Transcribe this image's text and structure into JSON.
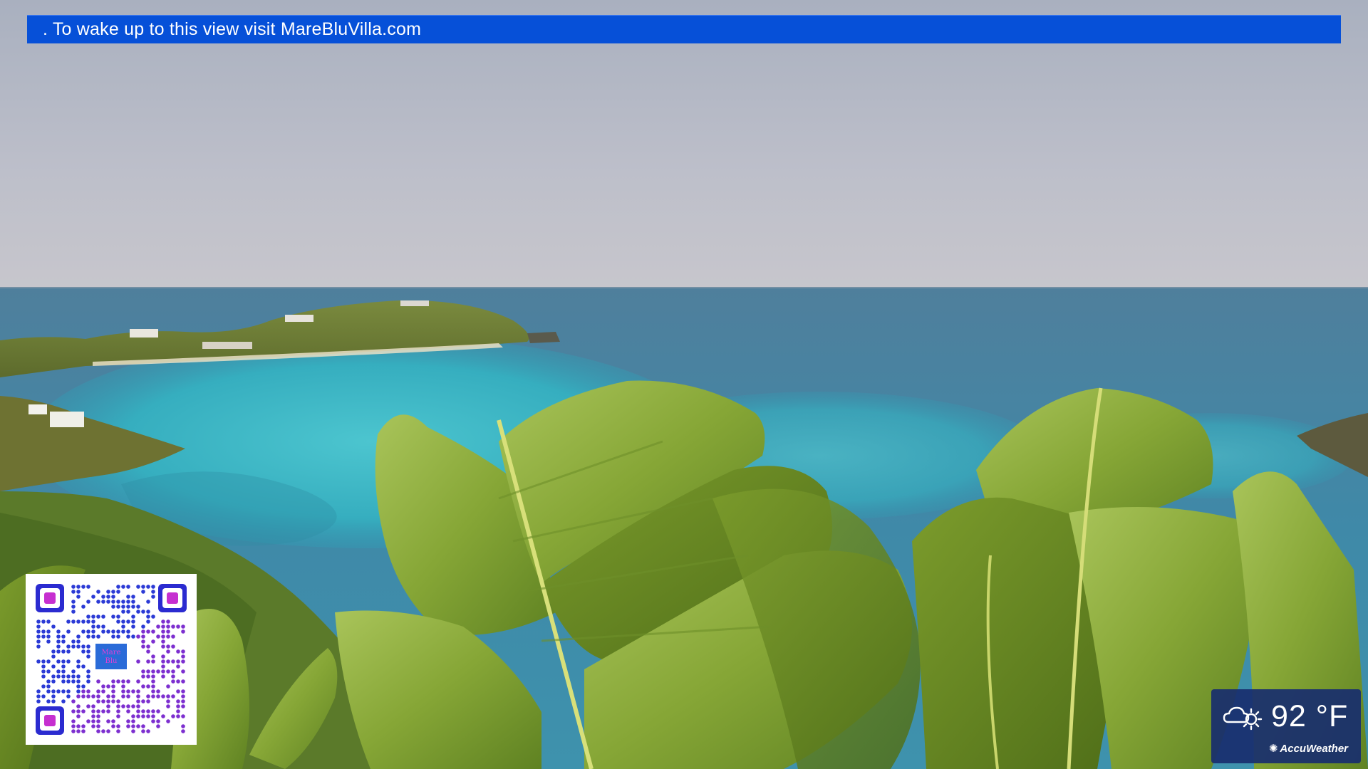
{
  "ticker": {
    "text": ". To wake up to this view visit MareBluVilla.com",
    "background": "#0650d8"
  },
  "qr": {
    "center_logo_text": [
      "Mare",
      "Blu"
    ],
    "accent_color": "#c62fd0",
    "module_color": "#2b2bd0"
  },
  "weather": {
    "icon": "partly-cloudy-sun-icon",
    "temperature": "92 °F",
    "brand": "AccuWeather",
    "brand_icon": "sun-burst-icon"
  },
  "scene": {
    "subject": "tropical bay",
    "sky_color": "#b9bcc6",
    "sea_color": "#3e8aa8",
    "lagoon_color": "#38b6c6",
    "leaf_color": "#8fae3a"
  }
}
